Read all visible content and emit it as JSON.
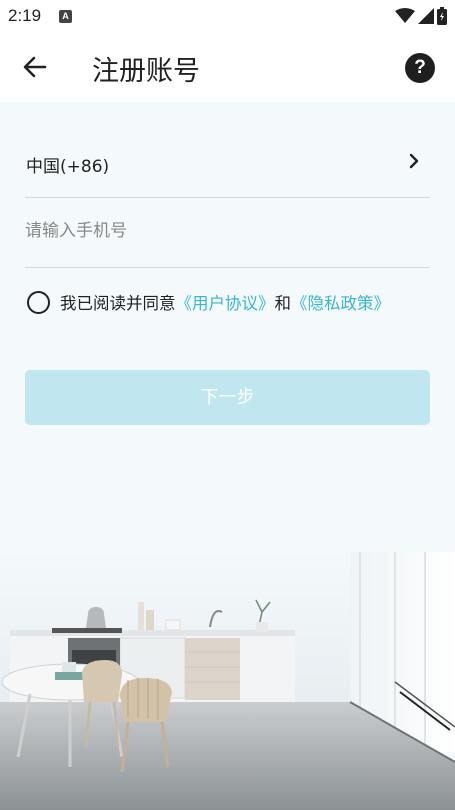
{
  "status_bar": {
    "time": "2:19",
    "notification_icon": "A"
  },
  "header": {
    "title": "注册账号",
    "help_symbol": "?"
  },
  "form": {
    "country_code": "中国(+86)",
    "phone_placeholder": "请输入手机号",
    "phone_value": "",
    "agreement": {
      "prefix": "我已阅读并同意",
      "user_agreement": "《用户协议》",
      "joiner": "和",
      "privacy_policy": "《隐私政策》"
    },
    "next_button": "下一步"
  },
  "colors": {
    "link": "#3cb4d0",
    "button_disabled": "#c0e6ef",
    "background": "#f4f9fc"
  },
  "icons": [
    "back-arrow-icon",
    "help-icon",
    "chevron-right-icon",
    "radio-unchecked-icon",
    "wifi-icon",
    "cell-signal-icon",
    "battery-icon"
  ]
}
